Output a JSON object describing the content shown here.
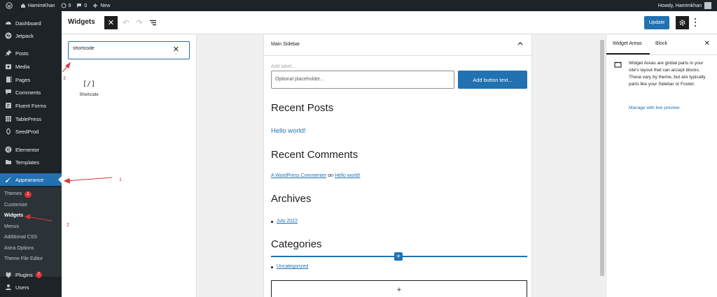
{
  "admin_bar": {
    "site_name": "HamimKhan",
    "updates_count": "9",
    "comments_count": "0",
    "new_label": "New",
    "howdy": "Howdy, Hamimkhan"
  },
  "menu": {
    "items": [
      {
        "label": "Dashboard",
        "icon": "dashboard-icon"
      },
      {
        "label": "Jetpack",
        "icon": "jetpack-icon"
      },
      {
        "label": "Posts",
        "icon": "pin-icon"
      },
      {
        "label": "Media",
        "icon": "media-icon"
      },
      {
        "label": "Pages",
        "icon": "pages-icon"
      },
      {
        "label": "Comments",
        "icon": "comment-icon"
      },
      {
        "label": "Fluent Forms",
        "icon": "form-icon"
      },
      {
        "label": "TablePress",
        "icon": "table-icon"
      },
      {
        "label": "SeedProd",
        "icon": "seed-icon"
      },
      {
        "label": "Elementor",
        "icon": "elementor-icon"
      },
      {
        "label": "Templates",
        "icon": "folder-icon"
      },
      {
        "label": "Appearance",
        "icon": "brush-icon"
      },
      {
        "label": "Plugins",
        "icon": "plugin-icon",
        "badge": "7"
      },
      {
        "label": "Users",
        "icon": "user-icon"
      }
    ],
    "submenu": [
      {
        "label": "Themes",
        "badge": "1"
      },
      {
        "label": "Customize"
      },
      {
        "label": "Widgets"
      },
      {
        "label": "Menus"
      },
      {
        "label": "Additional CSS"
      },
      {
        "label": "Astra Options"
      },
      {
        "label": "Theme File Editor"
      }
    ]
  },
  "header": {
    "title": "Widgets",
    "update_label": "Update"
  },
  "inserter": {
    "search_value": "shortcode",
    "result_icon": "[/]",
    "result_label": "Shortcode"
  },
  "widget_area": {
    "title": "Main Sidebar",
    "add_label": "Add label...",
    "input_placeholder": "Optional placeholder...",
    "button_text": "Add button text...",
    "recent_posts_heading": "Recent Posts",
    "recent_post_link": "Hello world!",
    "recent_comments_heading": "Recent Comments",
    "commenter": "A WordPress Commenter",
    "on_word": "on",
    "comment_post": "Hello world!",
    "archives_heading": "Archives",
    "archive_item": "July 2022",
    "categories_heading": "Categories",
    "category_item": "Uncategorized"
  },
  "settings": {
    "tab_widget_areas": "Widget Areas",
    "tab_block": "Block",
    "info_text": "Widget Areas are global parts in your site's layout that can accept blocks. These vary by theme, but are typically parts like your Sidebar or Footer.",
    "live_preview_link": "Manage with live preview"
  },
  "annotations": {
    "n1": "1",
    "n2": "2",
    "n3": "3",
    "color": "#d63638"
  },
  "colors": {
    "accent": "#2271b1",
    "admin_dark": "#1d2327",
    "badge_red": "#d63638"
  }
}
